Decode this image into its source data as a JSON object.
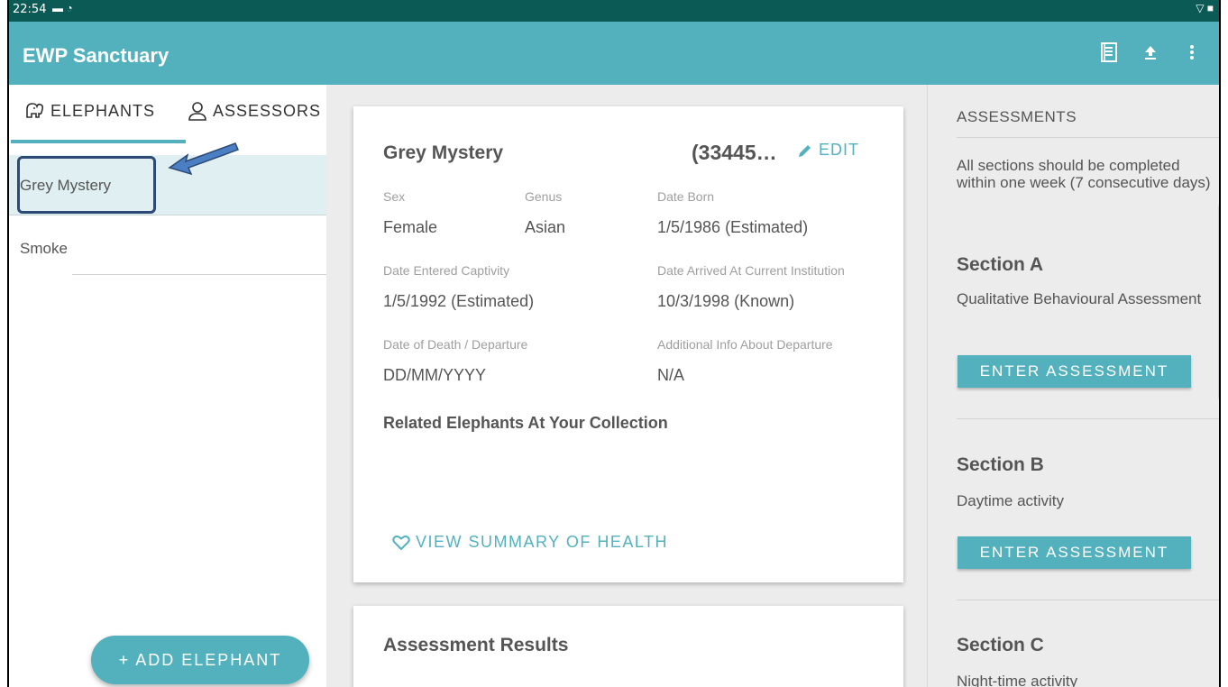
{
  "status_bar": {
    "time": "22:54"
  },
  "app": {
    "title": "EWP Sanctuary"
  },
  "tabs": [
    {
      "label": "ELEPHANTS",
      "icon": "elephant-icon"
    },
    {
      "label": "ASSESSORS",
      "icon": "person-icon"
    }
  ],
  "elephants": [
    {
      "name": "Grey Mystery"
    },
    {
      "name": "Smoke"
    }
  ],
  "add_button": {
    "label": "+ ADD ELEPHANT"
  },
  "detail": {
    "name": "Grey Mystery",
    "id": "(33445…",
    "edit_label": "EDIT",
    "fields": {
      "sex": {
        "label": "Sex",
        "value": "Female"
      },
      "genus": {
        "label": "Genus",
        "value": "Asian"
      },
      "date_born": {
        "label": "Date Born",
        "value": "1/5/1986 (Estimated)"
      },
      "date_entered": {
        "label": "Date Entered Captivity",
        "value": "1/5/1992 (Estimated)"
      },
      "date_arrived": {
        "label": "Date Arrived At Current Institution",
        "value": "10/3/1998 (Known)"
      },
      "date_death": {
        "label": "Date of Death / Departure",
        "value": "DD/MM/YYYY"
      },
      "additional_info": {
        "label": "Additional Info About Departure",
        "value": "N/A"
      }
    },
    "related_heading": "Related Elephants At Your Collection",
    "view_summary_label": "VIEW SUMMARY OF HEALTH"
  },
  "results": {
    "title": "Assessment Results"
  },
  "assessments": {
    "heading": "ASSESSMENTS",
    "note": "All sections should be completed within one week (7 consecutive days)",
    "sections": [
      {
        "title": "Section A",
        "description": "Qualitative Behavioural Assessment",
        "button": "ENTER ASSESSMENT"
      },
      {
        "title": "Section B",
        "description": "Daytime activity",
        "button": "ENTER ASSESSMENT"
      },
      {
        "title": "Section C",
        "description": "Night-time activity"
      }
    ]
  },
  "colors": {
    "accent": "#52b1bd",
    "status_bar": "#0b5a55",
    "selected_row": "#e0eff1",
    "highlight_box": "#2d4a74",
    "annotation_arrow": "#4a7fc4"
  }
}
